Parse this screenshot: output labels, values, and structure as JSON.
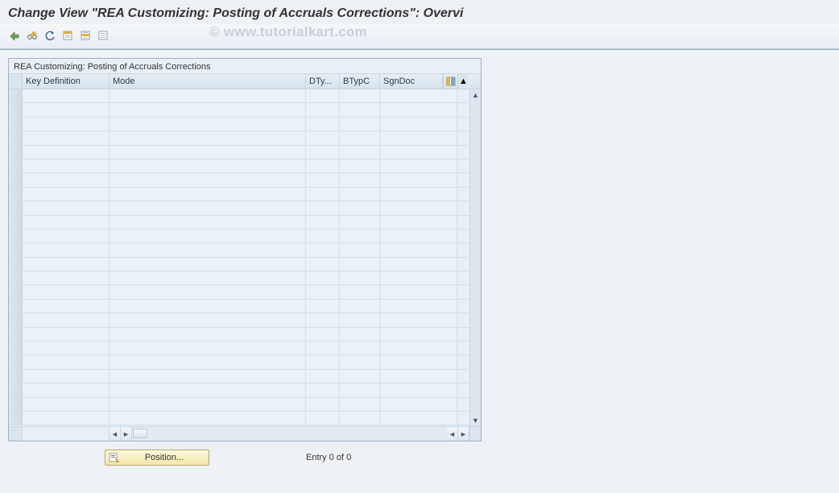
{
  "header": {
    "title": "Change View \"REA Customizing: Posting of Accruals Corrections\": Overvi"
  },
  "watermark": "© www.tutorialkart.com",
  "toolbar": {
    "icons": [
      "expand-icon",
      "glasses-pencil-icon",
      "undo-icon",
      "select-all-icon",
      "select-block-icon",
      "deselect-all-icon"
    ]
  },
  "grid": {
    "title": "REA Customizing: Posting of Accruals Corrections",
    "columns": {
      "keydef": "Key Definition",
      "mode": "Mode",
      "dty": "DTy...",
      "btypc": "BTypC",
      "sgndoc": "SgnDoc"
    },
    "row_count": 24
  },
  "footer": {
    "position_label": "Position...",
    "entry_status": "Entry 0 of 0"
  }
}
